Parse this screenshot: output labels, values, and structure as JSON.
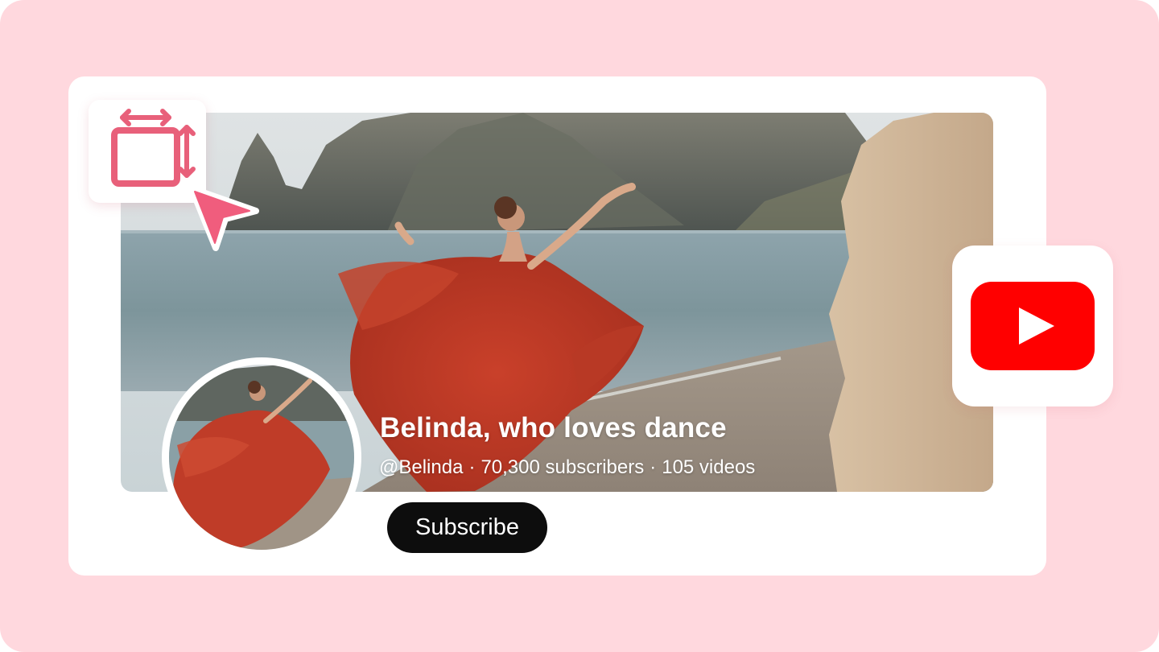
{
  "channel": {
    "name": "Belinda, who loves dance",
    "handle": "@Belinda",
    "subscribers": "70,300 subscribers",
    "videos": "105 videos",
    "separator": "·"
  },
  "actions": {
    "subscribe_label": "Subscribe"
  },
  "icons": {
    "resize": "resize-icon",
    "cursor": "cursor-pointer-icon",
    "platform": "youtube-logo-icon"
  },
  "colors": {
    "backdrop": "#ffd8de",
    "accent": "#e8607a",
    "youtube_red": "#ff0000",
    "button_bg": "#0d0d0d"
  }
}
